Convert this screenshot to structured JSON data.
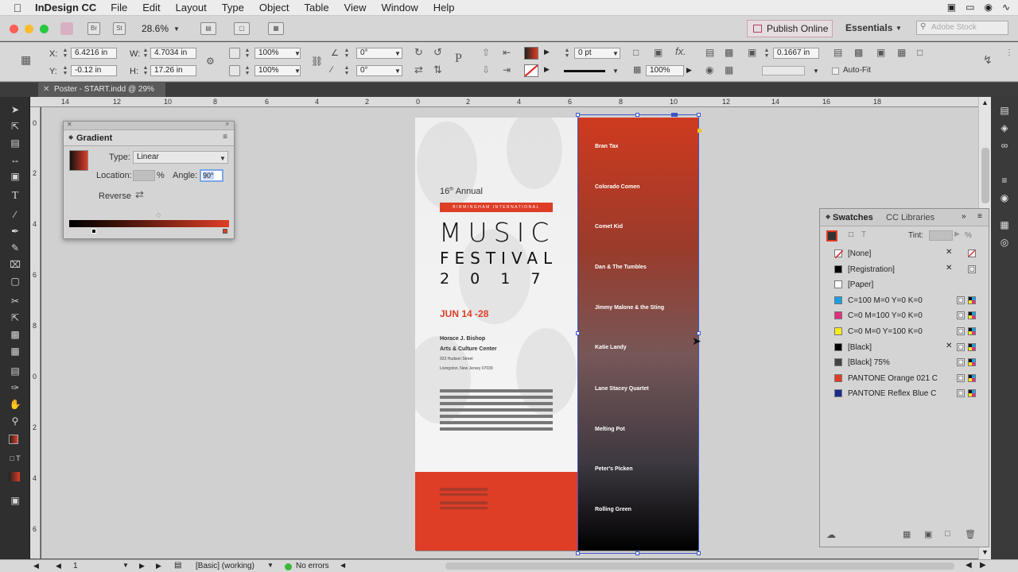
{
  "menubar": {
    "app_name": "InDesign CC",
    "items": [
      "File",
      "Edit",
      "Layout",
      "Type",
      "Object",
      "Table",
      "View",
      "Window",
      "Help"
    ]
  },
  "appbar": {
    "bridge_label": "Br",
    "stock_label": "St",
    "zoom": "28.6%",
    "publish_label": "Publish Online",
    "workspace": "Essentials",
    "search_placeholder": "Adobe Stock"
  },
  "control": {
    "x_label": "X:",
    "x_value": "6.4216 in",
    "y_label": "Y:",
    "y_value": "-0.12 in",
    "w_label": "W:",
    "w_value": "4.7034 in",
    "h_label": "H:",
    "h_value": "17.26 in",
    "scale_x": "100%",
    "scale_y": "100%",
    "rotate": "0°",
    "shear": "0°",
    "stroke_weight": "0 pt",
    "opacity": "100%",
    "offset": "0.1667 in",
    "autofit_label": "Auto-Fit"
  },
  "document_tab": {
    "title": "Poster - START.indd @ 29%"
  },
  "ruler": {
    "h_ticks": [
      "14",
      "12",
      "10",
      "8",
      "6",
      "4",
      "2",
      "0",
      "2",
      "4",
      "6",
      "8",
      "10",
      "12",
      "14",
      "16",
      "18"
    ],
    "v_ticks": [
      "0",
      "2",
      "4",
      "6",
      "8",
      "0",
      "2",
      "4",
      "6"
    ]
  },
  "gradient_panel": {
    "title": "Gradient",
    "type_label": "Type:",
    "type_value": "Linear",
    "location_label": "Location:",
    "location_unit": "%",
    "angle_label": "Angle:",
    "angle_value": "90°",
    "reverse_label": "Reverse"
  },
  "swatches_panel": {
    "tab_active": "Swatches",
    "tab_other": "CC Libraries",
    "tint_label": "Tint:",
    "tint_unit": "%",
    "swatches": [
      {
        "name": "[None]",
        "color": "#ffffff"
      },
      {
        "name": "[Registration]",
        "color": "#000000"
      },
      {
        "name": "[Paper]",
        "color": "#ffffff"
      },
      {
        "name": "C=100 M=0 Y=0 K=0",
        "color": "#1aa0e0"
      },
      {
        "name": "C=0 M=100 Y=0 K=0",
        "color": "#e0307f"
      },
      {
        "name": "C=0 M=0 Y=100 K=0",
        "color": "#f7ec1c"
      },
      {
        "name": "[Black]",
        "color": "#000000"
      },
      {
        "name": "[Black] 75%",
        "color": "#444444"
      },
      {
        "name": "PANTONE Orange 021 C",
        "color": "#de3d26"
      },
      {
        "name": "PANTONE Reflex Blue C",
        "color": "#1a2c8c"
      }
    ]
  },
  "status": {
    "page": "1",
    "preflight_profile": "[Basic] (working)",
    "errors": "No errors"
  },
  "poster": {
    "annual": "16",
    "annual_suffix": "th",
    "annual_word": "Annual",
    "banner": "BIRMINGHAM INTERNATIONAL",
    "title1": "MUSIC",
    "title2": "FESTIVAL",
    "year": "2 0 1 7",
    "dates": "JUN 14 -28",
    "venue1": "Horace J. Bishop",
    "venue2": "Arts & Culture Center",
    "address1": "923 Hudson Street",
    "address2": "Livingston, New Jersey 07039",
    "bands": [
      "Bran Tax",
      "Colorado Comen",
      "Comet Kid",
      "Dan & The Tumbles",
      "Jimmy Malone & the Sting",
      "Katie Landy",
      "Lane Stacey Quartet",
      "Melting Pot",
      "Peter's Picken",
      "Rolling Green"
    ]
  },
  "colors": {
    "accent_red": "#de3d26",
    "selection_blue": "#3b55c8"
  }
}
